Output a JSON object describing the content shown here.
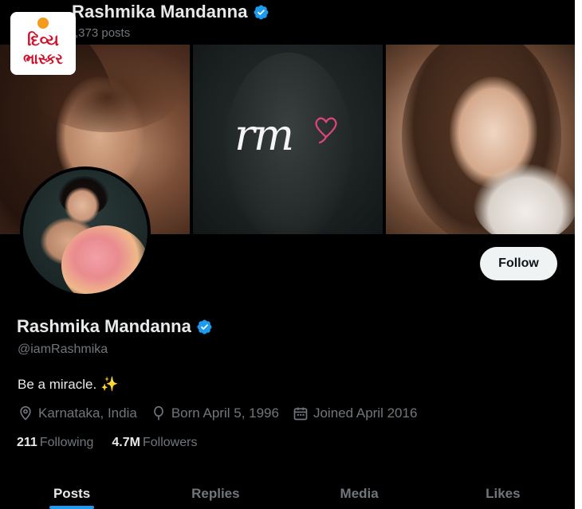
{
  "header": {
    "name": "Rashmika Mandanna",
    "posts_count": ",373 posts"
  },
  "watermark": {
    "line1": "દિવ્ય",
    "line2": "ભાસ્કર"
  },
  "banner": {
    "monogram": "rm"
  },
  "profile": {
    "display_name": "Rashmika Mandanna",
    "handle": "@iamRashmika",
    "bio": "Be a miracle.",
    "bio_emoji": "✨",
    "location": "Karnataka, India",
    "born": "Born April 5, 1996",
    "joined": "Joined April 2016",
    "following_count": "211",
    "following_label": "Following",
    "followers_count": "4.7M",
    "followers_label": "Followers",
    "follow_button": "Follow"
  },
  "tabs": [
    {
      "label": "Posts",
      "active": true
    },
    {
      "label": "Replies",
      "active": false
    },
    {
      "label": "Media",
      "active": false
    },
    {
      "label": "Likes",
      "active": false
    }
  ],
  "colors": {
    "background": "#000000",
    "text_primary": "#e7e9ea",
    "text_secondary": "#71767b",
    "verified_blue": "#1d9bf0",
    "follow_button_bg": "#eff3f4",
    "watermark_red": "#d0112b",
    "monogram_heart": "#e0457b"
  },
  "icons": {
    "verified": "verified-badge-icon",
    "location": "location-pin-icon",
    "birthday": "balloon-icon",
    "joined": "calendar-icon"
  }
}
